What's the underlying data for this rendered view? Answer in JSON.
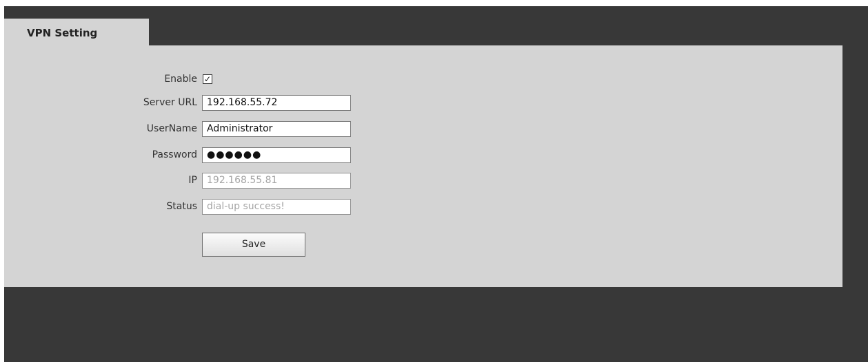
{
  "tab": {
    "title": "VPN Setting"
  },
  "form": {
    "enable": {
      "label": "Enable",
      "checked": true,
      "check_glyph": "✓"
    },
    "server_url": {
      "label": "Server URL",
      "value": "192.168.55.72"
    },
    "username": {
      "label": "UserName",
      "value": "Administrator"
    },
    "password": {
      "label": "Password",
      "masked_value": "●●●●●●"
    },
    "ip": {
      "label": "IP",
      "value": "192.168.55.81"
    },
    "status": {
      "label": "Status",
      "value": "dial-up success!"
    },
    "save_label": "Save"
  },
  "colors": {
    "frame": "#383838",
    "panel": "#d4d4d4",
    "readonly_text": "#a5a5a5"
  }
}
